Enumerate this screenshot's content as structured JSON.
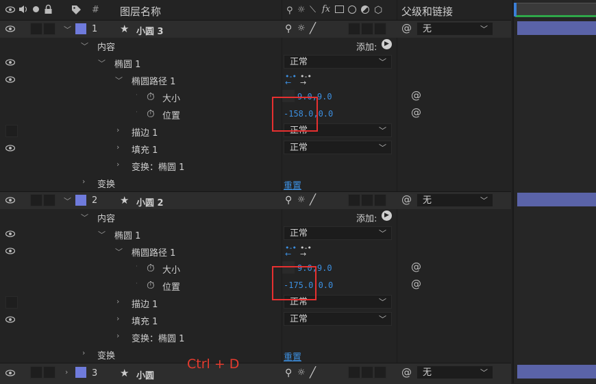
{
  "header": {
    "hash": "#",
    "layer_name": "图层名称",
    "switch_fx": "fx",
    "parent_link": "父级和链接"
  },
  "layers": [
    {
      "num": "1",
      "name": "小圆 3",
      "parent": "无",
      "contents": "内容",
      "add": "添加:",
      "ellipse": "椭圆 1",
      "blend": "正常",
      "path": "椭圆路径 1",
      "size_label": "大小",
      "size_value": "9.0,9.0",
      "pos_label": "位置",
      "pos_value": "-158.0,0.0",
      "stroke": "描边 1",
      "stroke_mode": "正常",
      "fill": "填充 1",
      "fill_mode": "正常",
      "transform_ellipse": "变换：椭圆 1",
      "transform": "变换",
      "reset": "重置"
    },
    {
      "num": "2",
      "name": "小圆 2",
      "parent": "无",
      "contents": "内容",
      "add": "添加:",
      "ellipse": "椭圆 1",
      "blend": "正常",
      "path": "椭圆路径 1",
      "size_label": "大小",
      "size_value": "9.0,9.0",
      "pos_label": "位置",
      "pos_value": "-175.0,0.0",
      "stroke": "描边 1",
      "stroke_mode": "正常",
      "fill": "填充 1",
      "fill_mode": "正常",
      "transform_ellipse": "变换：椭圆 1",
      "transform": "变换",
      "reset": "重置"
    },
    {
      "num": "3",
      "name": "小圆",
      "parent": "无"
    }
  ],
  "annotation": "Ctrl + D",
  "colors": {
    "label_swatch": "#6f7bdc",
    "value_blue": "#3c8fe0",
    "highlight_red": "#e83030",
    "annotation_red": "#e63b2e"
  }
}
